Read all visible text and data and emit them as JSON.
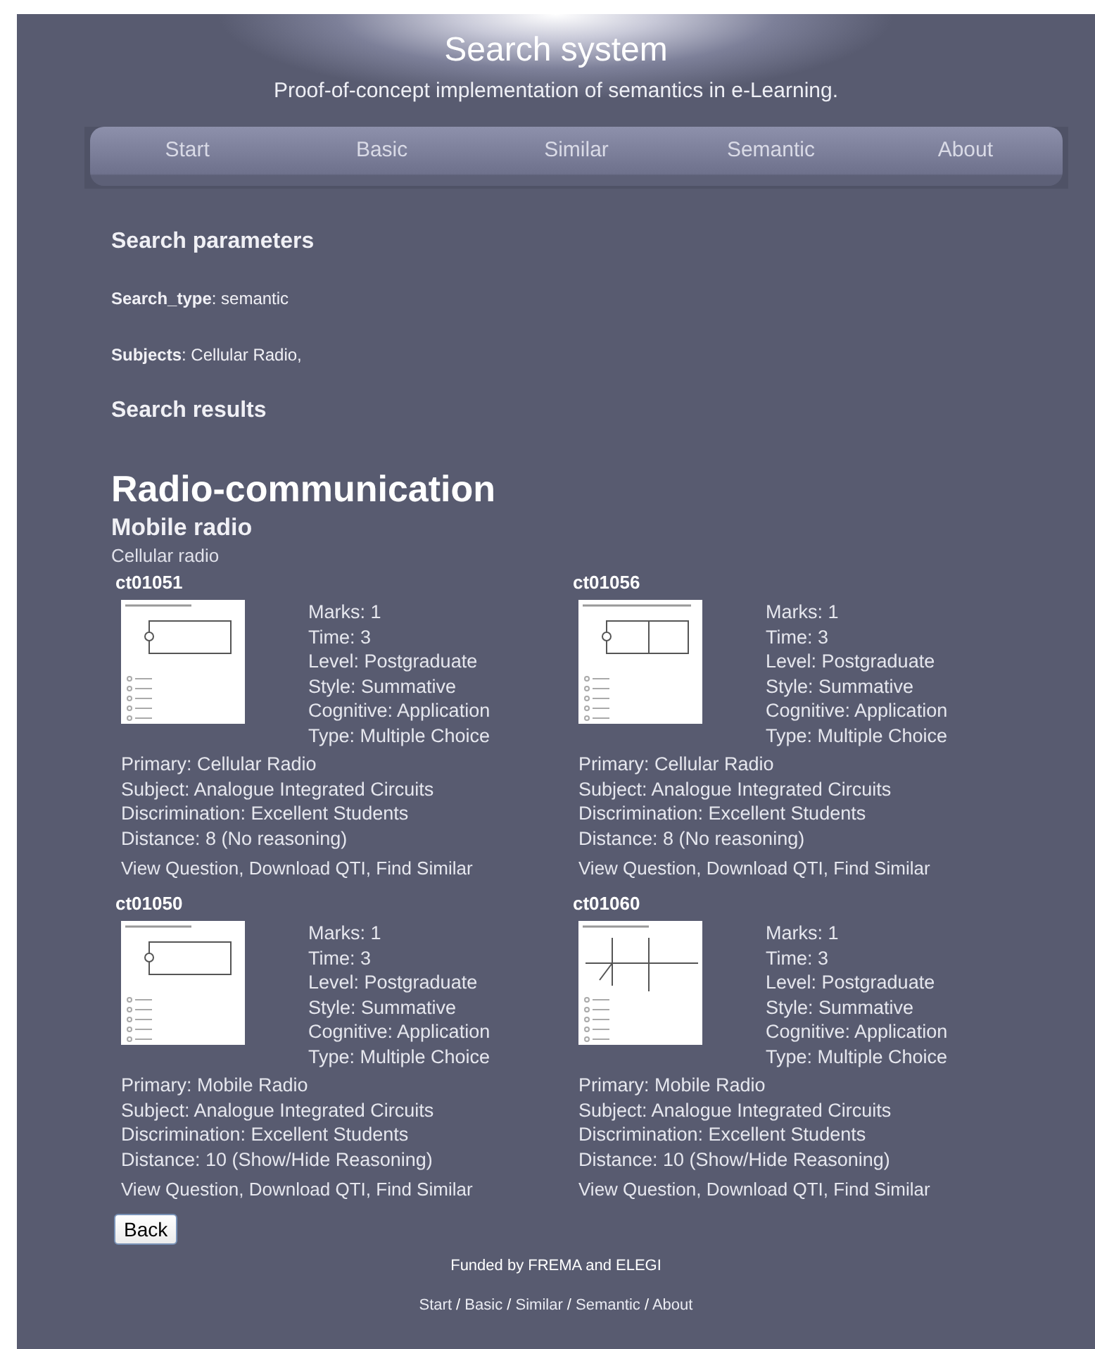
{
  "header": {
    "title": "Search system",
    "subtitle": "Proof-of-concept implementation of semantics in e-Learning."
  },
  "nav": [
    {
      "label": "Start"
    },
    {
      "label": "Basic"
    },
    {
      "label": "Similar"
    },
    {
      "label": "Semantic"
    },
    {
      "label": "About"
    }
  ],
  "parameters_heading": "Search parameters",
  "parameters": [
    {
      "label": "Search_type",
      "value": ": semantic"
    },
    {
      "label": "Subjects",
      "value": ": Cellular Radio,"
    }
  ],
  "results_heading": "Search results",
  "category": "Radio-communication",
  "subcategory": "Mobile radio",
  "topic": "Cellular radio",
  "results": [
    {
      "id": "ct01051",
      "details": [
        "Marks: 1",
        "Time: 3",
        "Level: Postgraduate",
        "Style: Summative",
        "Cognitive: Application",
        "Type: Multiple Choice"
      ],
      "info": [
        "Primary: Cellular Radio",
        "Subject: Analogue Integrated Circuits",
        "Discrimination: Excellent Students",
        "Distance: 8 (No reasoning)"
      ],
      "actions": [
        "View Question",
        "Download QTI",
        "Find Similar"
      ]
    },
    {
      "id": "ct01056",
      "details": [
        "Marks: 1",
        "Time: 3",
        "Level: Postgraduate",
        "Style: Summative",
        "Cognitive: Application",
        "Type: Multiple Choice"
      ],
      "info": [
        "Primary: Cellular Radio",
        "Subject: Analogue Integrated Circuits",
        "Discrimination: Excellent Students",
        "Distance: 8 (No reasoning)"
      ],
      "actions": [
        "View Question",
        "Download QTI",
        "Find Similar"
      ]
    },
    {
      "id": "ct01050",
      "details": [
        "Marks: 1",
        "Time: 3",
        "Level: Postgraduate",
        "Style: Summative",
        "Cognitive: Application",
        "Type: Multiple Choice"
      ],
      "info": [
        "Primary: Mobile Radio",
        "Subject: Analogue Integrated Circuits",
        "Discrimination: Excellent Students",
        "Distance: 10 (Show/Hide Reasoning)"
      ],
      "actions": [
        "View Question",
        "Download QTI",
        "Find Similar"
      ]
    },
    {
      "id": "ct01060",
      "details": [
        "Marks: 1",
        "Time: 3",
        "Level: Postgraduate",
        "Style: Summative",
        "Cognitive: Application",
        "Type: Multiple Choice"
      ],
      "info": [
        "Primary: Mobile Radio",
        "Subject: Analogue Integrated Circuits",
        "Discrimination: Excellent Students",
        "Distance: 10 (Show/Hide Reasoning)"
      ],
      "actions": [
        "View Question",
        "Download QTI",
        "Find Similar"
      ]
    }
  ],
  "action_separator": ",",
  "back_button": "Back",
  "footer": {
    "funded": "Funded by FREMA and ELEGI",
    "links": [
      {
        "label": "Start"
      },
      {
        "label": "Basic"
      },
      {
        "label": "Similar"
      },
      {
        "label": "Semantic"
      },
      {
        "label": "About"
      }
    ],
    "separator": "/"
  }
}
